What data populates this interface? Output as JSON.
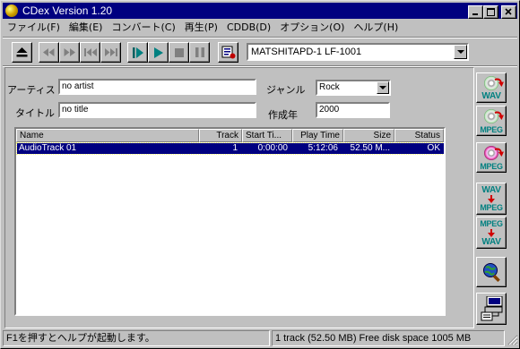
{
  "window": {
    "title": "CDex Version 1.20"
  },
  "menu": [
    "ファイル(F)",
    "編集(E)",
    "コンバート(C)",
    "再生(P)",
    "CDDB(D)",
    "オプション(O)",
    "ヘルプ(H)"
  ],
  "toolbar": {
    "drive": "MATSHITAPD-1 LF-1001"
  },
  "form": {
    "artist_label": "アーティスト",
    "artist_value": "no artist",
    "title_label": "タイトル",
    "title_value": "no title",
    "genre_label": "ジャンル",
    "genre_value": "Rock",
    "year_label": "作成年",
    "year_value": "2000"
  },
  "tracks": {
    "columns": [
      "Name",
      "Track",
      "Start Ti...",
      "Play Time",
      "Size",
      "Status"
    ],
    "rows": [
      {
        "name": "AudioTrack 01",
        "track": "1",
        "start": "0:00:00",
        "play": "5:12:06",
        "size": "52.50 M...",
        "status": "OK"
      }
    ]
  },
  "sidebar": {
    "btn1_label": "WAV",
    "btn2_label": "MPEG",
    "btn3_label": "MPEG",
    "btn4_top": "WAV",
    "btn4_bottom": "MPEG",
    "btn5_top": "MPEG",
    "btn5_bottom": "WAV"
  },
  "status": {
    "help": "F1を押すとヘルプが起動します。",
    "info": "1 track (52.50 MB) Free disk space  1005 MB"
  }
}
